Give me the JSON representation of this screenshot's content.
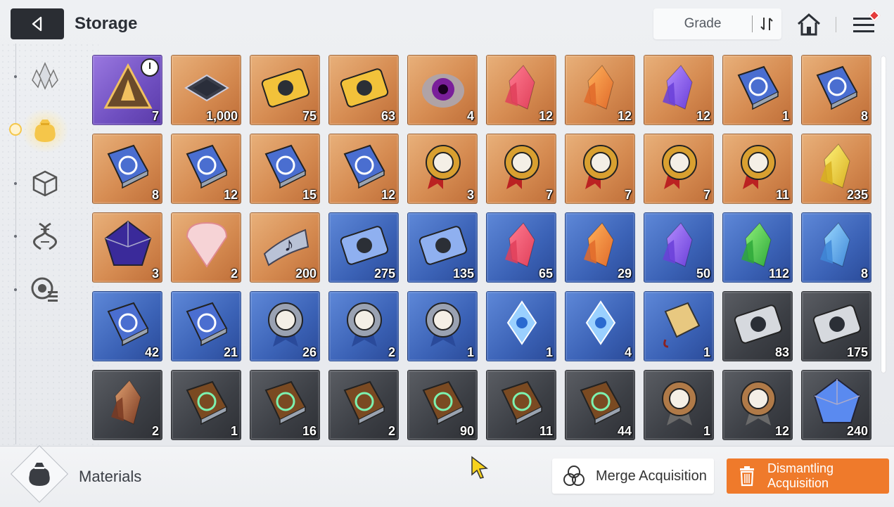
{
  "header": {
    "title": "Storage",
    "grade_label": "Grade"
  },
  "sidebar": {
    "items": [
      {
        "icon": "crystal-cluster-icon",
        "active": false
      },
      {
        "icon": "material-bag-icon",
        "active": true
      },
      {
        "icon": "cube-icon",
        "active": false
      },
      {
        "icon": "dna-helix-icon",
        "active": false
      },
      {
        "icon": "module-list-icon",
        "active": false
      }
    ]
  },
  "colors": {
    "purple": "#7a58cc",
    "orange": "#d68c52",
    "blue": "#3b62b6",
    "gray": "#3c3f45",
    "accent": "#ef7a2b"
  },
  "items": [
    {
      "icon": "triangle-token-icon",
      "rarity": "purple",
      "qty": "7",
      "timer": true
    },
    {
      "icon": "chip-icon",
      "rarity": "orange",
      "qty": "1,000"
    },
    {
      "icon": "gold-ticket-portrait-icon",
      "rarity": "orange",
      "qty": "75"
    },
    {
      "icon": "gold-ticket-star-icon",
      "rarity": "orange",
      "qty": "63"
    },
    {
      "icon": "eye-orb-icon",
      "rarity": "orange",
      "qty": "4"
    },
    {
      "icon": "red-crystal-icon",
      "rarity": "orange",
      "qty": "12"
    },
    {
      "icon": "orange-crystal-icon",
      "rarity": "orange",
      "qty": "12"
    },
    {
      "icon": "purple-crystal-icon",
      "rarity": "orange",
      "qty": "12"
    },
    {
      "icon": "blueprint-book-icon",
      "rarity": "orange",
      "qty": "1"
    },
    {
      "icon": "blueprint-book-icon",
      "rarity": "orange",
      "qty": "8"
    },
    {
      "icon": "blueprint-book-icon",
      "rarity": "orange",
      "qty": "8"
    },
    {
      "icon": "blueprint-book-icon",
      "rarity": "orange",
      "qty": "12"
    },
    {
      "icon": "blueprint-book-icon",
      "rarity": "orange",
      "qty": "15"
    },
    {
      "icon": "blueprint-book-icon",
      "rarity": "orange",
      "qty": "12"
    },
    {
      "icon": "gold-medal-icon",
      "rarity": "orange",
      "qty": "3"
    },
    {
      "icon": "gold-medal-icon",
      "rarity": "orange",
      "qty": "7"
    },
    {
      "icon": "gold-medal-icon",
      "rarity": "orange",
      "qty": "7"
    },
    {
      "icon": "gold-medal-icon",
      "rarity": "orange",
      "qty": "7"
    },
    {
      "icon": "gold-medal-icon",
      "rarity": "orange",
      "qty": "11"
    },
    {
      "icon": "yellow-shards-icon",
      "rarity": "orange",
      "qty": "235"
    },
    {
      "icon": "dark-cube-gem-icon",
      "rarity": "orange",
      "qty": "3"
    },
    {
      "icon": "guitar-pick-icon",
      "rarity": "orange",
      "qty": "2"
    },
    {
      "icon": "music-ribbon-icon",
      "rarity": "orange",
      "qty": "200"
    },
    {
      "icon": "blue-ticket-portrait-icon",
      "rarity": "blue",
      "qty": "275"
    },
    {
      "icon": "blue-ticket-star-icon",
      "rarity": "blue",
      "qty": "135"
    },
    {
      "icon": "red-crystal-icon",
      "rarity": "blue",
      "qty": "65"
    },
    {
      "icon": "orange-crystal-icon",
      "rarity": "blue",
      "qty": "29"
    },
    {
      "icon": "purple-crystal-icon",
      "rarity": "blue",
      "qty": "50"
    },
    {
      "icon": "green-crystal-icon",
      "rarity": "blue",
      "qty": "112"
    },
    {
      "icon": "blue-crystal-icon",
      "rarity": "blue",
      "qty": "8"
    },
    {
      "icon": "blueprint-book-icon",
      "rarity": "blue",
      "qty": "42"
    },
    {
      "icon": "blueprint-book-icon",
      "rarity": "blue",
      "qty": "21"
    },
    {
      "icon": "silver-medal-icon",
      "rarity": "blue",
      "qty": "26"
    },
    {
      "icon": "silver-medal-icon",
      "rarity": "blue",
      "qty": "2"
    },
    {
      "icon": "silver-medal-icon",
      "rarity": "blue",
      "qty": "1"
    },
    {
      "icon": "ice-gem-icon",
      "rarity": "blue",
      "qty": "1"
    },
    {
      "icon": "cake-slice-icon",
      "rarity": "blue",
      "qty": "4"
    },
    {
      "icon": "tag-charm-icon",
      "rarity": "blue",
      "qty": "1"
    },
    {
      "icon": "silver-ticket-portrait-icon",
      "rarity": "gray",
      "qty": "83"
    },
    {
      "icon": "silver-ticket-star-icon",
      "rarity": "gray",
      "qty": "175"
    },
    {
      "icon": "copper-shard-icon",
      "rarity": "gray",
      "qty": "2"
    },
    {
      "icon": "brown-book-icon",
      "rarity": "gray",
      "qty": "1"
    },
    {
      "icon": "brown-book-icon",
      "rarity": "gray",
      "qty": "16"
    },
    {
      "icon": "brown-book-icon",
      "rarity": "gray",
      "qty": "2"
    },
    {
      "icon": "brown-book-icon",
      "rarity": "gray",
      "qty": "90"
    },
    {
      "icon": "brown-book-icon",
      "rarity": "gray",
      "qty": "11"
    },
    {
      "icon": "brown-book-icon",
      "rarity": "gray",
      "qty": "44"
    },
    {
      "icon": "bronze-medal-icon",
      "rarity": "gray",
      "qty": "1"
    },
    {
      "icon": "bronze-medal-icon",
      "rarity": "gray",
      "qty": "12"
    },
    {
      "icon": "blue-cube-crystal-icon",
      "rarity": "gray",
      "qty": "240"
    }
  ],
  "footer": {
    "category": "Materials",
    "merge_label": "Merge Acquisition",
    "dismantle_label": "Dismantling Acquisition"
  }
}
